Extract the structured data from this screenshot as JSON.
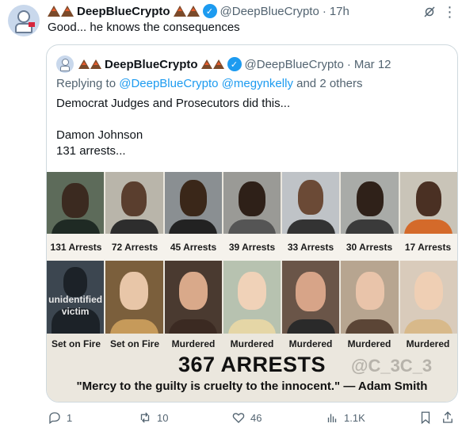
{
  "tweet": {
    "author": {
      "name": "DeepBlueCrypto",
      "handle": "@DeepBlueCrypto",
      "time": "17h",
      "separator": "·"
    },
    "text": "Good... he knows the consequences",
    "icons": {
      "avatar": "astronaut-avatar-icon",
      "menu": "grok-icon",
      "more": "more-icon",
      "verified": "verified-badge-icon"
    },
    "colors": {
      "accent": "#1d9bf0",
      "muted": "#536471",
      "border": "#cfd9de"
    }
  },
  "quote": {
    "author": {
      "name": "DeepBlueCrypto",
      "handle": "@DeepBlueCrypto",
      "time": "Mar 12",
      "separator": "·"
    },
    "replying": {
      "prefix": "Replying to",
      "mention1": "@DeepBlueCrypto",
      "mention2": "@megynkelly",
      "suffix": "and 2 others"
    },
    "body": "Democrat Judges and Prosecutors did this...\n\nDamon Johnson\n131 arrests..."
  },
  "image": {
    "row1_labels": [
      "131 Arrests",
      "72 Arrests",
      "45 Arrests",
      "39 Arrests",
      "33 Arrests",
      "30 Arrests",
      "17 Arrests"
    ],
    "row2_labels": [
      "Set on Fire",
      "Set on Fire",
      "Murdered",
      "Murdered",
      "Murdered",
      "Murdered",
      "Murdered"
    ],
    "unidentified_line1": "unidentified",
    "unidentified_line2": "victim",
    "total": "367 ARRESTS",
    "watermark": "@C_3C_3",
    "quote": "\"Mercy to the guilty is cruelty to the innocent.\" — Adam Smith"
  },
  "actions": {
    "reply": "1",
    "retweet": "10",
    "like": "46",
    "views": "1.1K"
  }
}
